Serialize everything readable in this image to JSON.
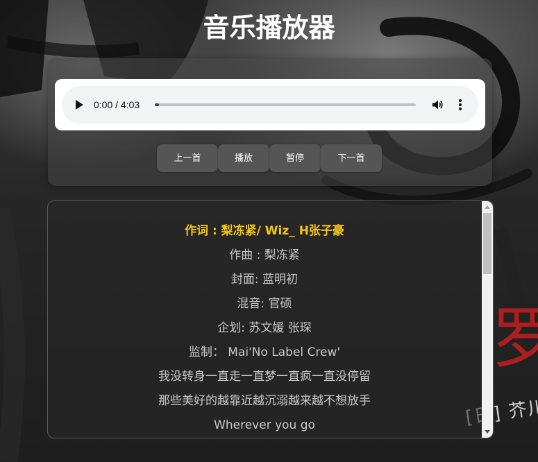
{
  "app": {
    "title": "音乐播放器"
  },
  "player": {
    "current_time": "0:00",
    "duration": "4:03",
    "time_display": "0:00 / 4:03",
    "progress_fraction": 0.015,
    "play_icon": "play-icon",
    "volume_icon": "volume-icon",
    "more_icon": "more-options-icon"
  },
  "controls": {
    "prev_label": "上一首",
    "play_label": "播放",
    "pause_label": "暂停",
    "next_label": "下一首"
  },
  "lyrics": {
    "active_index": 0,
    "lines": [
      "作词 : 梨冻紧/ Wiz_ H张子豪",
      "作曲 : 梨冻紧",
      "封面: 蓝明初",
      "混音: 官硕",
      "企划: 苏文媛 张琛",
      "监制：  Mai'No Label Crew'",
      "我没转身一直走一直梦一直疯一直没停留",
      "那些美好的越靠近越沉溺越来越不想放手",
      "Wherever you go"
    ]
  },
  "background": {
    "red_glyph": "罗",
    "caption": "[日] 芥川"
  },
  "colors": {
    "active_lyric": "#f5c518",
    "lyric_text": "#c8c8c8",
    "button_bg": "#555555",
    "panel_bg": "rgba(70,70,70,0.55)"
  }
}
